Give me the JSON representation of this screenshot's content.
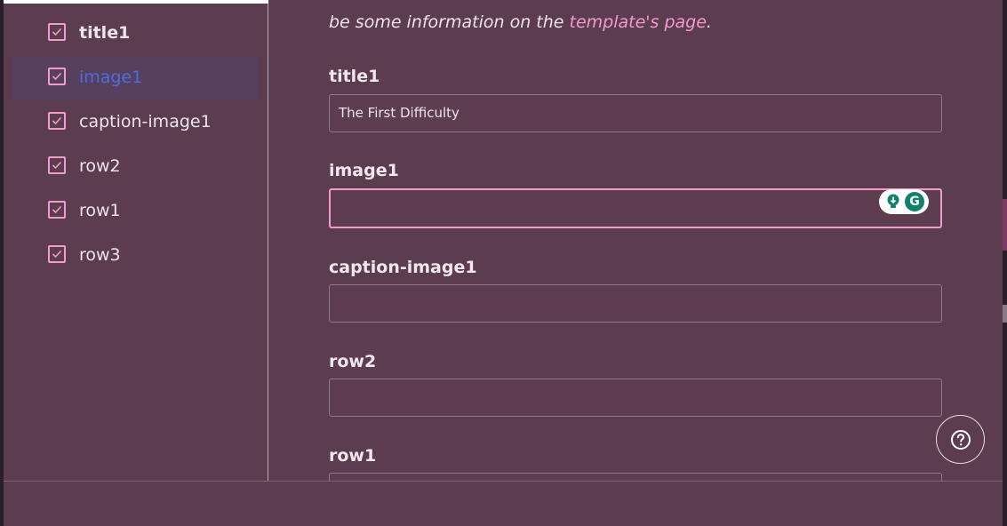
{
  "sidebar": {
    "items": [
      {
        "label": "title1",
        "checked": true
      },
      {
        "label": "image1",
        "checked": true,
        "selected": true
      },
      {
        "label": "caption-image1",
        "checked": true
      },
      {
        "label": "row2",
        "checked": true
      },
      {
        "label": "row1",
        "checked": true
      },
      {
        "label": "row3",
        "checked": true
      }
    ]
  },
  "main": {
    "intro_text": "be some information on the ",
    "intro_link": "template's page",
    "intro_end": ".",
    "fields": [
      {
        "label": "title1",
        "value": "The First Difficulty"
      },
      {
        "label": "image1",
        "value": "",
        "focused": true
      },
      {
        "label": "caption-image1",
        "value": ""
      },
      {
        "label": "row2",
        "value": ""
      },
      {
        "label": "row1",
        "value": ""
      }
    ]
  },
  "icons": {
    "checkbox": "checkbox-checked-icon",
    "grammarly_bulb": "lightbulb-icon",
    "grammarly_logo": "grammarly-g-icon",
    "help": "question-circle-icon"
  },
  "grammarly": {
    "letter": "G"
  },
  "colors": {
    "background": "#5c3c4f",
    "accent_pink": "#f29bd0",
    "selected_text_blue": "#4a6ee0",
    "selected_item_bg": "#56405e",
    "grammarly_green": "#12806a"
  }
}
